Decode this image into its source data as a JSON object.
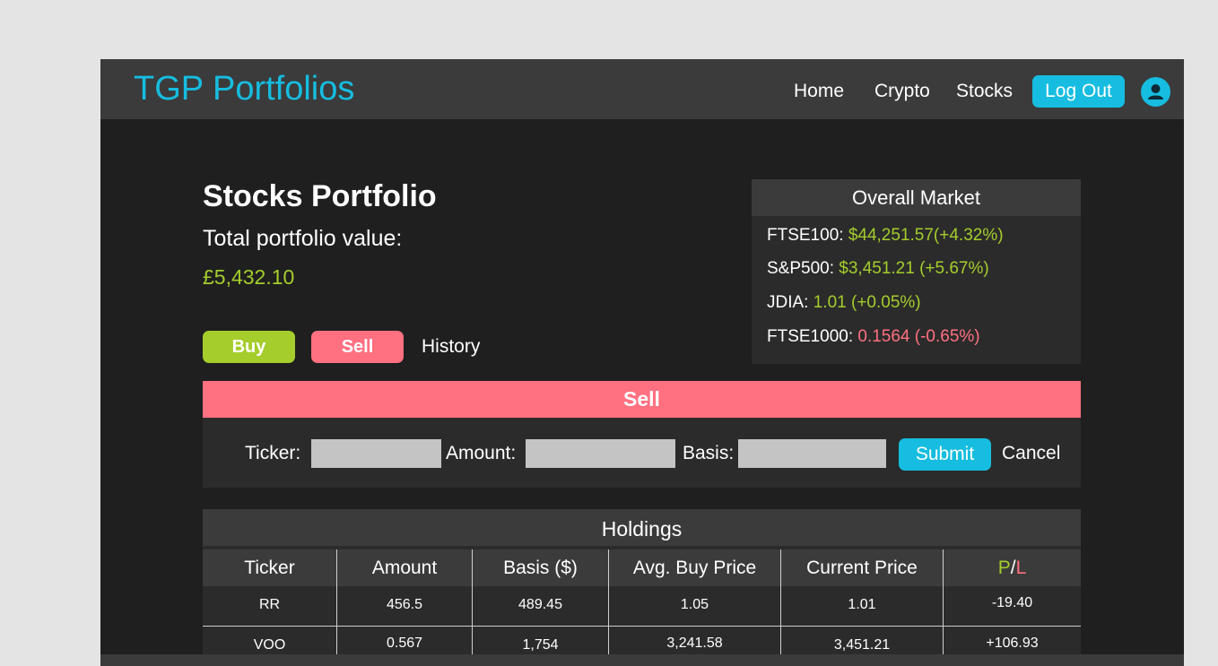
{
  "navbar": {
    "brand": "TGP Portfolios",
    "links": [
      "Home",
      "Crypto",
      "Stocks"
    ],
    "logout_label": "Log Out"
  },
  "portfolio": {
    "title": "Stocks Portfolio",
    "total_label": "Total portfolio value:",
    "total_value": "£5,432.10"
  },
  "actions": {
    "buy": "Buy",
    "sell": "Sell",
    "history": "History"
  },
  "market": {
    "title": "Overall Market",
    "rows": [
      {
        "name": "FTSE100: ",
        "value": "$44,251.57(+4.32%)",
        "status": "up"
      },
      {
        "name": "S&P500: ",
        "value": "$3,451.21 (+5.67%)",
        "status": "up"
      },
      {
        "name": "JDIA: ",
        "value": "1.01 (+0.05%)",
        "status": "up"
      },
      {
        "name": "FTSE1000: ",
        "value": "0.1564 (-0.65%)",
        "status": "down"
      }
    ]
  },
  "sell_form": {
    "title": "Sell",
    "ticker_label": "Ticker:",
    "amount_label": "Amount:",
    "basis_label": "Basis:",
    "ticker_value": "",
    "amount_value": "",
    "basis_value": "",
    "submit": "Submit",
    "cancel": "Cancel"
  },
  "holdings": {
    "title": "Holdings",
    "columns": [
      "Ticker",
      "Amount",
      "Basis ($)",
      "Avg. Buy Price",
      "Current Price"
    ],
    "pl_profit": "P",
    "pl_slash": "/",
    "pl_loss": "L",
    "rows": [
      {
        "ticker": "RR",
        "amount": "456.5",
        "basis": "489.45",
        "avg": "1.05",
        "current": "1.01",
        "pl": "-19.40",
        "status": "down"
      },
      {
        "ticker": "VOO",
        "amount": "0.567",
        "basis": "1,754",
        "avg": "3,241.58",
        "current": "3,451.21",
        "pl": "+106.93",
        "status": "up"
      }
    ]
  },
  "colors": {
    "accent": "#16bde0",
    "profit": "#a5cd2c",
    "loss": "#ff7080",
    "background": "#1f1f1f",
    "panel": "#2b2b2b"
  },
  "icons": {
    "avatar": "user-avatar-icon"
  }
}
